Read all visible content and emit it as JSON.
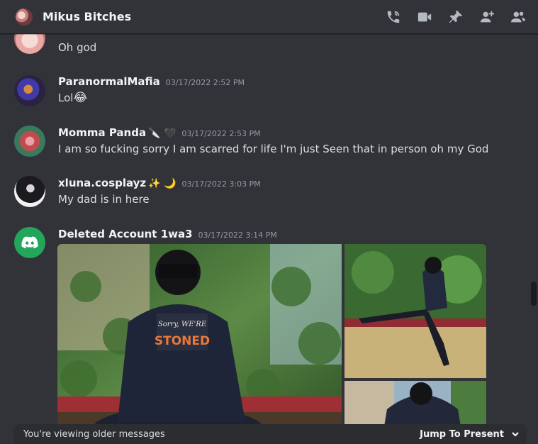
{
  "header": {
    "title": "Mikus Bitches",
    "icons": [
      "voice-call-icon",
      "video-call-icon",
      "pin-icon",
      "add-member-icon",
      "member-list-icon"
    ]
  },
  "messages": [
    {
      "content": "Oh god"
    },
    {
      "username": "ParanormalMafia",
      "timestamp": "03/17/2022 2:52 PM",
      "content": "Lol",
      "content_emoji": "😂"
    },
    {
      "username": "Momma Panda",
      "badges": "🔪 🖤",
      "timestamp": "03/17/2022 2:53 PM",
      "content": "I am so fucking sorry I am scarred for life I'm just Seen  that in person oh my God"
    },
    {
      "username": "xluna.cosplayz",
      "badges": "✨ 🌙",
      "timestamp": "03/17/2022 3:03 PM",
      "content": "My dad is in here"
    },
    {
      "username": "Deleted Account 1wa3",
      "timestamp": "03/17/2022 3:14 PM"
    }
  ],
  "attachments": {
    "main_shirt_line1": "Sorry, WE'RE",
    "main_shirt_line2": "STONED"
  },
  "older_bar": {
    "text": "You're viewing older messages",
    "jump_label": "Jump To Present"
  },
  "colors": {
    "background": "#313338",
    "accent_discord": "#23a55a",
    "username": "#f2f3f5",
    "timestamp": "#949ba4"
  }
}
